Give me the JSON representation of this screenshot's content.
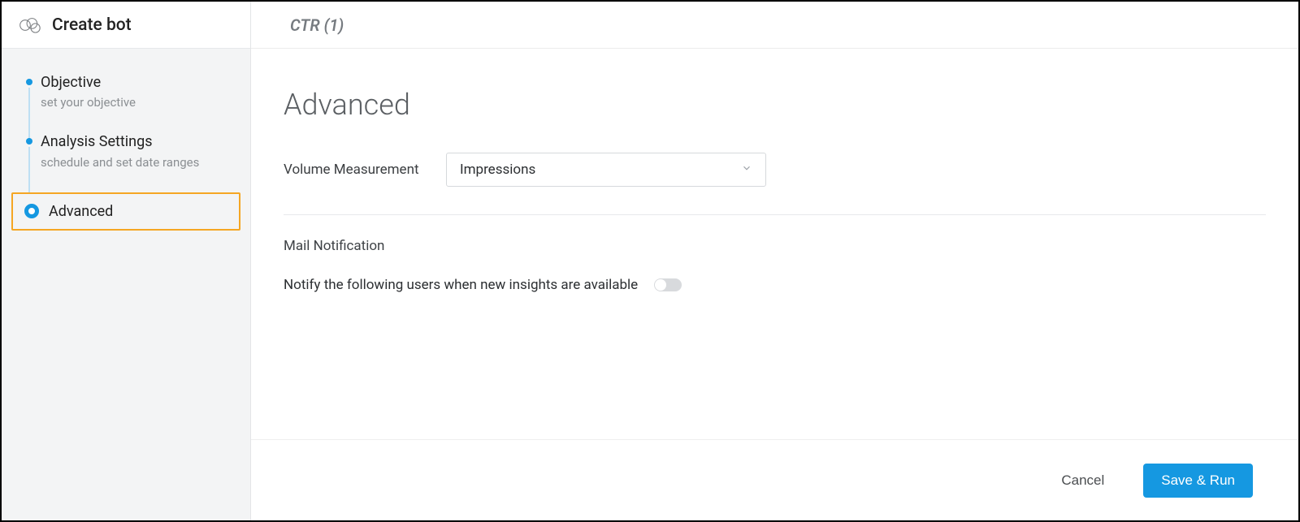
{
  "sidebar": {
    "title": "Create bot",
    "steps": [
      {
        "title": "Objective",
        "subtitle": "set your objective",
        "active": false
      },
      {
        "title": "Analysis Settings",
        "subtitle": "schedule and set date ranges",
        "active": false
      },
      {
        "title": "Advanced",
        "subtitle": "",
        "active": true
      }
    ]
  },
  "header": {
    "bot_name": "CTR (1)"
  },
  "main": {
    "heading": "Advanced",
    "volume_measurement": {
      "label": "Volume Measurement",
      "selected": "Impressions"
    },
    "mail_notification": {
      "section_label": "Mail Notification",
      "text": "Notify the following users when new insights are available",
      "enabled": false
    }
  },
  "footer": {
    "cancel": "Cancel",
    "save_run": "Save & Run"
  },
  "colors": {
    "accent": "#1598e1",
    "highlight_border": "#f5a623"
  }
}
